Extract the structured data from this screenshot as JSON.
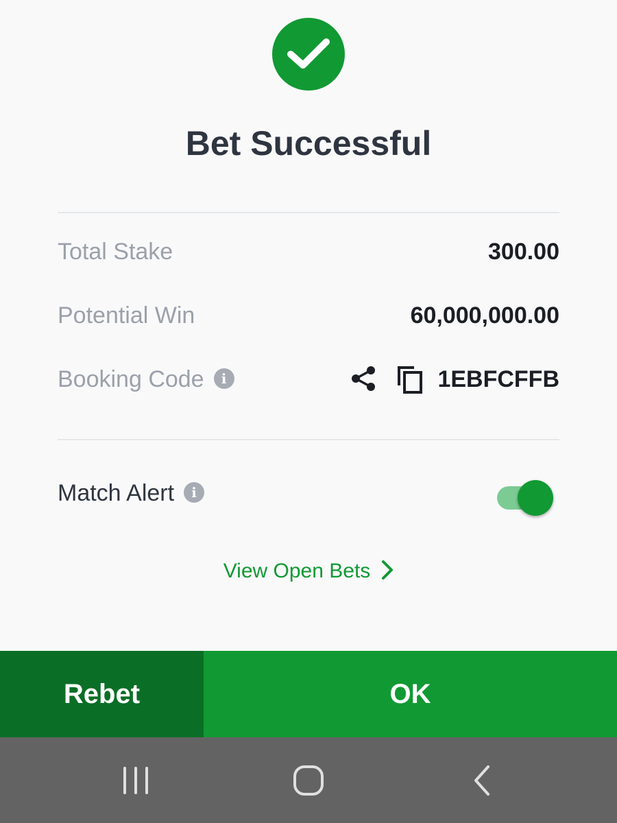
{
  "dialog": {
    "title": "Bet Successful",
    "success_icon": "check-circle-icon"
  },
  "summary": {
    "total_stake_label": "Total Stake",
    "total_stake_value": "300.00",
    "potential_win_label": "Potential Win",
    "potential_win_value": "60,000,000.00",
    "booking_code_label": "Booking Code",
    "booking_code_value": "1EBFCFFB",
    "info_icon": "info-icon",
    "share_icon": "share-icon",
    "copy_icon": "copy-icon"
  },
  "match_alert": {
    "label": "Match Alert",
    "enabled": true
  },
  "links": {
    "view_open_bets": "View Open Bets"
  },
  "actions": {
    "rebet_label": "Rebet",
    "ok_label": "OK"
  },
  "system_nav": {
    "recents": "recents-icon",
    "home": "home-icon",
    "back": "back-icon"
  },
  "colors": {
    "accent": "#119933",
    "accent_dark": "#0b6e26",
    "navbar": "#636363"
  }
}
